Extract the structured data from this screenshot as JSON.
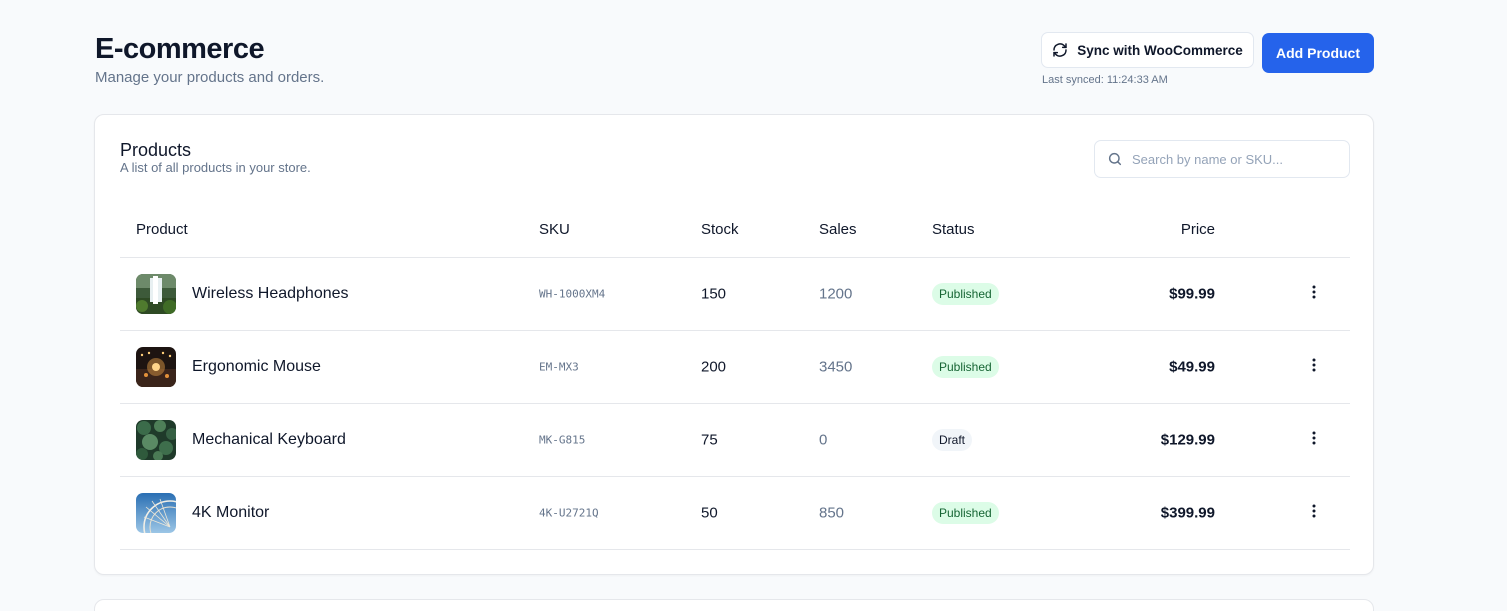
{
  "header": {
    "title": "E-commerce",
    "subtitle": "Manage your products and orders.",
    "sync_label": "Sync with WooCommerce",
    "last_synced": "Last synced: 11:24:33 AM",
    "add_label": "Add Product"
  },
  "products_card": {
    "title": "Products",
    "subtitle": "A list of all products in your store.",
    "search_placeholder": "Search by name or SKU..."
  },
  "table": {
    "columns": {
      "product": "Product",
      "sku": "SKU",
      "stock": "Stock",
      "sales": "Sales",
      "status": "Status",
      "price": "Price"
    },
    "rows": [
      {
        "name": "Wireless Headphones",
        "sku": "WH-1000XM4",
        "stock": "150",
        "sales": "1200",
        "status": "Published",
        "price": "$99.99",
        "thumb": "waterfall"
      },
      {
        "name": "Ergonomic Mouse",
        "sku": "EM-MX3",
        "stock": "200",
        "sales": "3450",
        "status": "Published",
        "price": "$49.99",
        "thumb": "lights"
      },
      {
        "name": "Mechanical Keyboard",
        "sku": "MK-G815",
        "stock": "75",
        "sales": "0",
        "status": "Draft",
        "price": "$129.99",
        "thumb": "foliage"
      },
      {
        "name": "4K Monitor",
        "sku": "4K-U2721Q",
        "stock": "50",
        "sales": "850",
        "status": "Published",
        "price": "$399.99",
        "thumb": "ferris-wheel"
      }
    ]
  },
  "icons": {
    "sync": "refresh-icon",
    "search": "search-icon",
    "row_menu": "more-vertical-icon"
  },
  "colors": {
    "primary": "#2563eb",
    "published_bg": "#dcfce7",
    "published_text": "#166534",
    "draft_bg": "#f1f5f9"
  }
}
